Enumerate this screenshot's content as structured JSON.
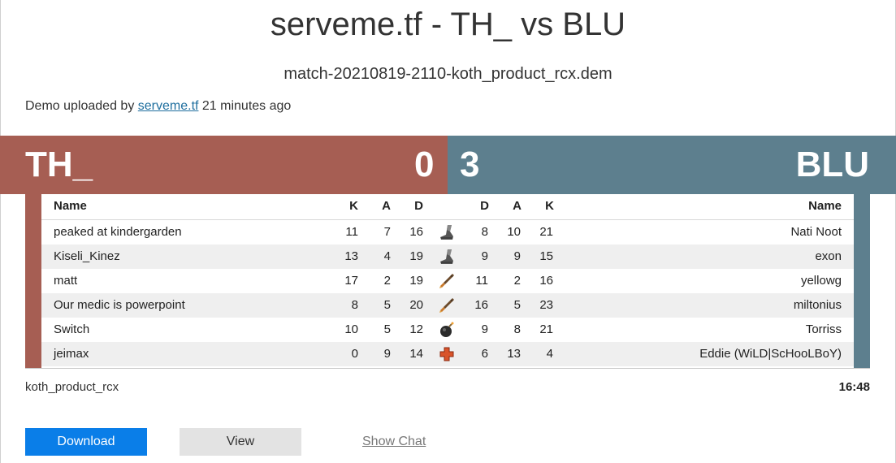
{
  "header": {
    "title": "serveme.tf - TH_ vs BLU",
    "filename": "match-20210819-2110-koth_product_rcx.dem",
    "uploaded_prefix": "Demo uploaded by ",
    "uploader": "serveme.tf",
    "uploaded_suffix": " 21 minutes ago"
  },
  "teams": {
    "red": {
      "name": "TH_",
      "score": "0",
      "color": "#a65e53"
    },
    "blue": {
      "name": "BLU",
      "score": "3",
      "color": "#5d7f8e"
    }
  },
  "table": {
    "headers": {
      "name_left": "Name",
      "k_left": "K",
      "a_left": "A",
      "d_left": "D",
      "d_right": "D",
      "a_right": "A",
      "k_right": "K",
      "name_right": "Name"
    },
    "rows": [
      {
        "red_name": "peaked at kindergarden",
        "red_k": "11",
        "red_a": "7",
        "red_d": "16",
        "class_icon": "scout-boot-icon",
        "blue_d": "8",
        "blue_a": "10",
        "blue_k": "21",
        "blue_name": "Nati Noot"
      },
      {
        "red_name": "Kiseli_Kinez",
        "red_k": "13",
        "red_a": "4",
        "red_d": "19",
        "class_icon": "scout-boot-icon",
        "blue_d": "9",
        "blue_a": "9",
        "blue_k": "15",
        "blue_name": "exon"
      },
      {
        "red_name": "matt",
        "red_k": "17",
        "red_a": "2",
        "red_d": "19",
        "class_icon": "rocket-icon",
        "blue_d": "11",
        "blue_a": "2",
        "blue_k": "16",
        "blue_name": "yellowg"
      },
      {
        "red_name": "Our medic is powerpoint",
        "red_k": "8",
        "red_a": "5",
        "red_d": "20",
        "class_icon": "rocket-icon",
        "blue_d": "16",
        "blue_a": "5",
        "blue_k": "23",
        "blue_name": "miltonius"
      },
      {
        "red_name": "Switch",
        "red_k": "10",
        "red_a": "5",
        "red_d": "12",
        "class_icon": "bomb-icon",
        "blue_d": "9",
        "blue_a": "8",
        "blue_k": "21",
        "blue_name": "Torriss"
      },
      {
        "red_name": "jeimax",
        "red_k": "0",
        "red_a": "9",
        "red_d": "14",
        "class_icon": "medic-cross-icon",
        "blue_d": "6",
        "blue_a": "13",
        "blue_k": "4",
        "blue_name": "Eddie (WiLD|ScHooLBoY)"
      }
    ]
  },
  "footer": {
    "map": "koth_product_rcx",
    "duration": "16:48"
  },
  "actions": {
    "download": "Download",
    "view": "View",
    "show_chat": "Show Chat"
  },
  "colors": {
    "download_button": "#0a7ee8",
    "link": "#1e6e9e"
  }
}
